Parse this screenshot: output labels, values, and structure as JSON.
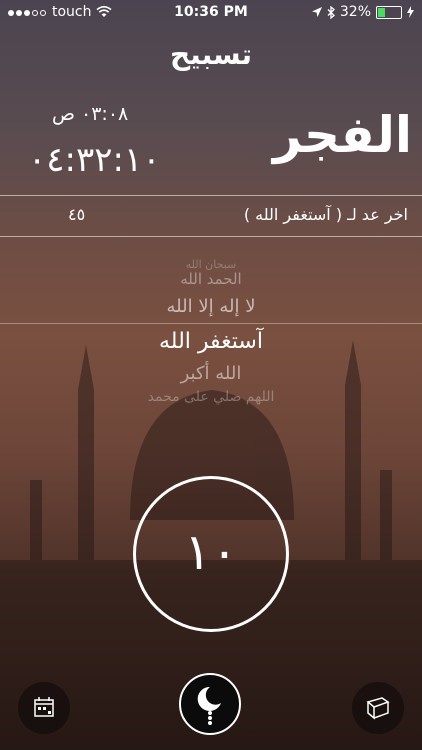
{
  "status_bar": {
    "carrier": "touch",
    "time": "10:36 PM",
    "battery": "32%",
    "battery_level": 0.32
  },
  "title": "تسبيح",
  "prayer": {
    "name": "الفجر",
    "time": "٠٣:٠٨ ص",
    "countdown": "٠٤:٣٢:١٠"
  },
  "last_count": {
    "label": "اخر عد لـ ( آستغفر الله )",
    "value": "٤٥"
  },
  "picker": {
    "items": [
      "سبحان الله",
      "الحمد الله",
      "لا إله إلا الله",
      "آستغفر الله",
      "الله أكبر",
      "اللهم صلي على محمد"
    ],
    "selected_index": 3
  },
  "counter": {
    "value": "١٠"
  },
  "icons": {
    "left": "calendar-icon",
    "center": "crescent-tasbih-icon",
    "right": "book-icon"
  }
}
